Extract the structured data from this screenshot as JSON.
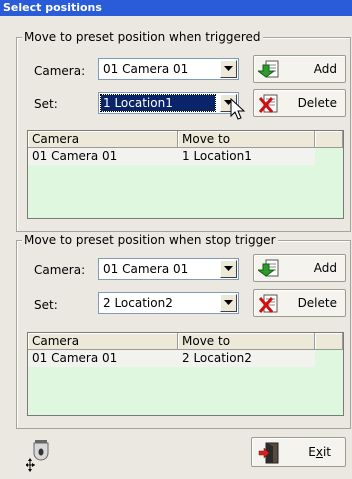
{
  "window": {
    "title": "Select positions"
  },
  "section_trigger": {
    "legend": "Move to preset position when triggered",
    "camera_label": "Camera:",
    "camera_value": "01 Camera 01",
    "set_label": "Set:",
    "set_value": "1 Location1",
    "add_label": "Add",
    "delete_label": "Delete",
    "table": {
      "headers": [
        "Camera",
        "Move to"
      ],
      "rows": [
        [
          "01 Camera 01",
          "1 Location1"
        ]
      ]
    }
  },
  "section_stop": {
    "legend": "Move to preset position when stop trigger",
    "camera_label": "Camera:",
    "camera_value": "01 Camera 01",
    "set_label": "Set:",
    "set_value": "2 Location2",
    "add_label": "Add",
    "delete_label": "Delete",
    "table": {
      "headers": [
        "Camera",
        "Move to"
      ],
      "rows": [
        [
          "01 Camera 01",
          "2 Location2"
        ]
      ]
    }
  },
  "footer": {
    "exit_label": "Exit",
    "exit_hotkey_letter": "x"
  },
  "icons": {
    "add": "add-document-icon",
    "delete": "delete-document-icon",
    "exit": "exit-door-icon",
    "ptz": "ptz-camera-icon",
    "cursor": "mouse-cursor-icon"
  },
  "colors": {
    "titlebar": "#2a5bd8",
    "grid_background": "#dff7df",
    "selection": "#0a246a"
  }
}
